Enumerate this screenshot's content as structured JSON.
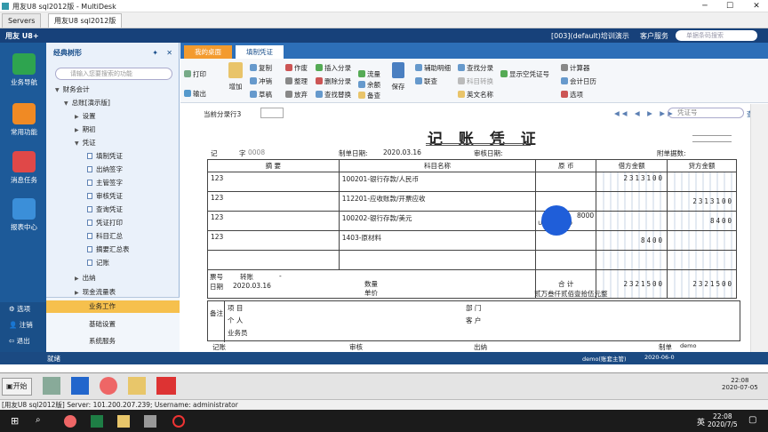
{
  "window": {
    "title": "用友U8 sql2012版 - MultiDesk"
  },
  "tabs": [
    {
      "label": "Servers"
    },
    {
      "label": "用友U8 sql2012版"
    }
  ],
  "u8": {
    "logo": "用友 U8+",
    "info": "[003](default)培训演示",
    "customer_service": "客户服务",
    "search_placeholder": "单据条码搜索"
  },
  "leftnav": {
    "items": [
      "业务导航",
      "常用功能",
      "消息任务",
      "报表中心"
    ],
    "bottom": [
      "选项",
      "注销",
      "退出"
    ]
  },
  "tree": {
    "title": "经典树形",
    "search_placeholder": "请输入您要搜索的功能",
    "items": [
      "财务会计",
      "总账[演示版]",
      "设置",
      "期初",
      "凭证",
      "填制凭证",
      "出纳签字",
      "主管签字",
      "审核凭证",
      "查询凭证",
      "凭证打印",
      "科目汇总",
      "摘要汇总表",
      "记账",
      "出纳",
      "现金流量表"
    ]
  },
  "workitems": [
    "业务工作",
    "基础设置",
    "系统服务"
  ],
  "doctabs": [
    "我的桌面",
    "填制凭证"
  ],
  "toolbar": {
    "print": "打印",
    "export": "输出",
    "add": "增加",
    "copy": "复制",
    "flush": "冲销",
    "draft": "草稿",
    "void": "作废",
    "organize": "整理",
    "abandon": "放弃",
    "insert_entry": "插入分录",
    "delete_entry": "删除分录",
    "find_replace": "查找替换",
    "flow": "流量",
    "balance": "余额",
    "memo": "备查",
    "save": "保存",
    "aux": "辅助明细",
    "linked": "联查",
    "find_entry": "查找分录",
    "num_convert": "科目转换",
    "en_name": "英文名称",
    "show_empty": "显示空凭证号",
    "calc": "计算器",
    "calendar": "会计日历",
    "options": "选项"
  },
  "voucher": {
    "entry_row": "当前分录行3",
    "nav_placeholder": "凭证号",
    "query": "查询",
    "title": "记 账 凭 证",
    "type": "记",
    "zi": "字",
    "number": "0008",
    "date_label": "制单日期:",
    "date": "2020.03.16",
    "audit_label": "审核日期:",
    "attach_label": "附单据数:",
    "headers": [
      "摘 要",
      "科目名称",
      "原 币",
      "借方金额",
      "贷方金额"
    ],
    "rows": [
      {
        "summary": "123",
        "account": "100201-银行存款/人民币",
        "orig": "",
        "debit": "2313100",
        "credit": ""
      },
      {
        "summary": "123",
        "account": "112201-应收账款/开票应收",
        "orig": "",
        "debit": "",
        "credit": "2313100"
      },
      {
        "summary": "123",
        "account": "100202-银行存款/美元",
        "orig": "8000",
        "orig_sub": "USD 2 8000",
        "debit": "",
        "credit": "8400"
      },
      {
        "summary": "123",
        "account": "1403-原材料",
        "orig": "",
        "debit": "8400",
        "credit": ""
      },
      {
        "summary": "",
        "account": "",
        "orig": "",
        "debit": "",
        "credit": ""
      }
    ],
    "bill_no_label": "票号",
    "bill_no": "转账",
    "bill_date_label": "日期",
    "bill_date": "2020.03.16",
    "qty_label": "数量",
    "unit_label": "单价",
    "total_label": "合 计",
    "total_debit": "2321500",
    "total_credit": "2321500",
    "amount_words": "贰万叁仟贰佰壹拾伍元整",
    "note_label": "备注",
    "project_label": "项 目",
    "person_label": "个 人",
    "salesman_label": "业务员",
    "dept_label": "部 门",
    "customer_label": "客 户",
    "bottom_labels": [
      "记账",
      "审核",
      "出纳",
      "制单"
    ],
    "maker": "demo"
  },
  "status": {
    "ready": "就绪",
    "user": "demo(账套主管)",
    "date": "2020-06-0"
  },
  "remote_taskbar": {
    "start": "开始",
    "time": "22:08",
    "date": "2020-07-05"
  },
  "md_status": "[用友U8 sql2012版] Server: 101.200.207.239; Username: administrator",
  "win_taskbar": {
    "time": "22:08",
    "date": "2020/7/5",
    "ime": "英"
  }
}
